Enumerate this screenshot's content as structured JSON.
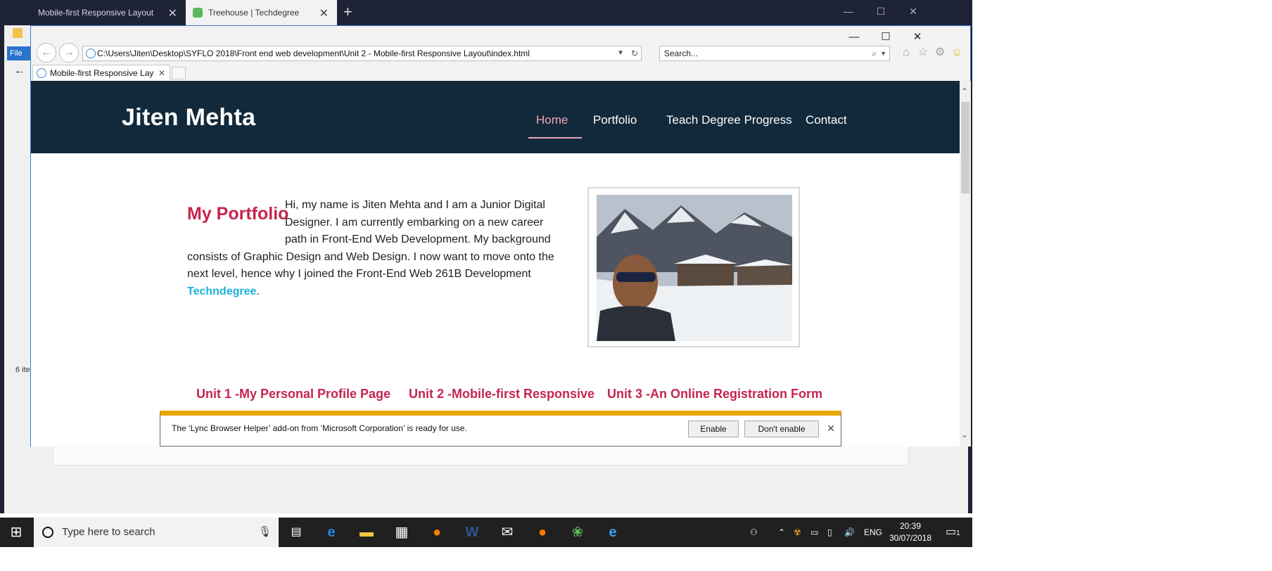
{
  "bg_browser": {
    "tabs": [
      {
        "label": "Mobile-first Responsive Layout",
        "active": false
      },
      {
        "label": "Treehouse | Techdegree",
        "active": true
      }
    ],
    "new_tab": "+"
  },
  "explorer": {
    "ribbon_label": "File",
    "status": "6 ite"
  },
  "ie": {
    "address": "C:\\Users\\Jiten\\Desktop\\SYFLO 2018\\Front end web development\\Unit 2 - Mobile-first Responsive Layout\\index.html",
    "search_placeholder": "Search...",
    "tab_label": "Mobile-first Responsive Lay"
  },
  "site": {
    "brand": "Jiten Mehta",
    "nav": [
      {
        "label": "Home",
        "active": true
      },
      {
        "label": "Portfolio",
        "active": false
      },
      {
        "label": "Teach Degree Progress",
        "active": false
      },
      {
        "label": "Contact",
        "active": false
      }
    ],
    "portfolio_title": "My Portfolio",
    "intro_text": "Hi, my name is Jiten Mehta and I am a Junior Digital Designer. I am currently embarking on a new career path in Front-End Web Development. My background consists of Graphic Design and Web Design. I now want to move onto the next level, hence why I joined the Front-End Web 261B Development ",
    "intro_link": "Techndegree",
    "intro_end": ".",
    "units": [
      "Unit 1 -My Personal Profile Page",
      "Unit 2 -Mobile-first Responsive",
      "Unit 3 -An Online Registration Form"
    ]
  },
  "notification": {
    "message": "The ‘Lync Browser Helper’ add-on from ‘Microsoft Corporation’ is ready for use.",
    "enable": "Enable",
    "dont_enable": "Don't enable"
  },
  "taskbar": {
    "search_placeholder": "Type here to search",
    "language": "ENG",
    "time": "20:39",
    "date": "30/07/2018",
    "notification_count": "1"
  },
  "colors": {
    "site_header": "#11293b",
    "accent_pink": "#c7254e",
    "link_blue": "#1fb0db",
    "notify_bar": "#e7a600"
  }
}
